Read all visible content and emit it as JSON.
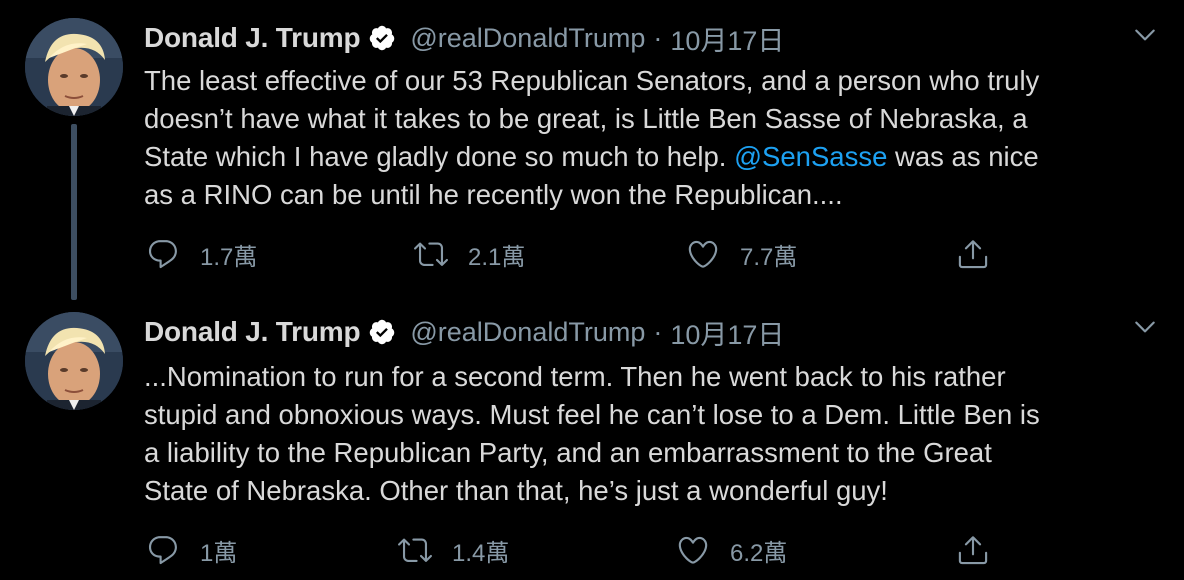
{
  "colors": {
    "background": "#000000",
    "text": "#d9d9d9",
    "muted": "#8899a6",
    "link": "#1da1f2",
    "thread_line": "#3d4e61"
  },
  "tweets": [
    {
      "author_name": "Donald J. Trump",
      "handle": "@realDonaldTrump",
      "separator": "·",
      "date": "10月17日",
      "verified_icon": "verified-badge-icon",
      "menu_icon": "chevron-down-icon",
      "lines": [
        {
          "text": "The least effective of our 53 Republican Senators, and a person who truly"
        },
        {
          "text": "doesn’t have what it takes to be great, is Little Ben Sasse of Nebraska, a"
        },
        {
          "pre": "State which I have gladly done so much to help. ",
          "mention": "@SenSasse",
          "post": " was as nice"
        },
        {
          "text": "as a RINO can be until he recently won the Republican...."
        }
      ],
      "replies": "1.7萬",
      "retweets": "2.1萬",
      "likes": "7.7萬"
    },
    {
      "author_name": "Donald J. Trump",
      "handle": "@realDonaldTrump",
      "separator": "·",
      "date": "10月17日",
      "verified_icon": "verified-badge-icon",
      "menu_icon": "chevron-down-icon",
      "lines": [
        {
          "text": "...Nomination to run for a second term. Then he went back to his rather"
        },
        {
          "text": "stupid and obnoxious ways. Must feel he can’t lose to a Dem. Little Ben is"
        },
        {
          "text": "a liability to the Republican Party, and an embarrassment to the Great"
        },
        {
          "text": "State of Nebraska. Other than that, he’s just a wonderful guy!"
        }
      ],
      "replies": "1萬",
      "retweets": "1.4萬",
      "likes": "6.2萬"
    }
  ]
}
